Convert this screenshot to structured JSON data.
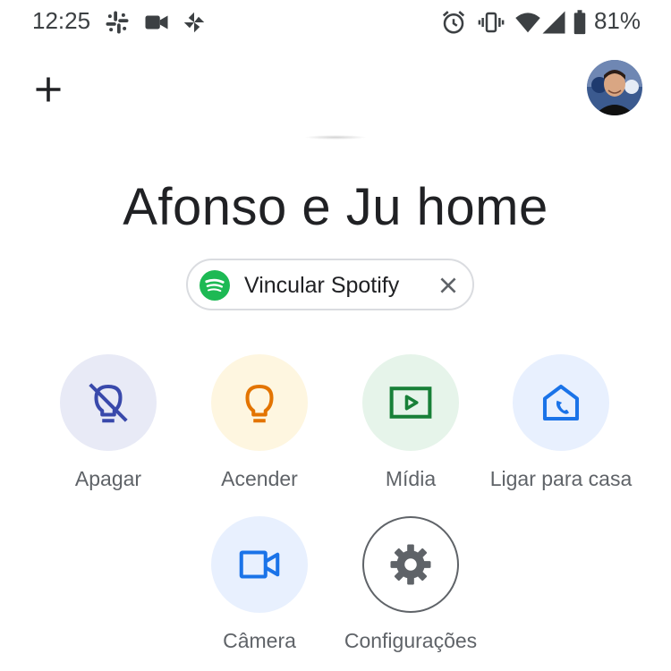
{
  "status_bar": {
    "time": "12:25",
    "battery": "81%",
    "left_icons": [
      "slack-icon",
      "video-call-icon",
      "pinwheel-app-icon"
    ],
    "right_icons": [
      "alarm-icon",
      "vibrate-icon",
      "wifi-icon",
      "signal-icon",
      "battery-icon"
    ]
  },
  "header": {
    "add_icon": "plus-icon",
    "avatar": "profile-avatar"
  },
  "home": {
    "title": "Afonso e Ju home"
  },
  "chip": {
    "label": "Vincular Spotify",
    "icon": "spotify-icon",
    "close_icon": "close-icon"
  },
  "actions": [
    {
      "label": "Apagar",
      "icon": "lightbulb-off-icon",
      "bg": "#e8eaf6",
      "fg": "#3949ab"
    },
    {
      "label": "Acender",
      "icon": "lightbulb-icon",
      "bg": "#fef6e0",
      "fg": "#e37400"
    },
    {
      "label": "Mídia",
      "icon": "play-media-icon",
      "bg": "#e6f4ea",
      "fg": "#188038"
    },
    {
      "label": "Ligar para casa",
      "icon": "home-call-icon",
      "bg": "#e8f0fe",
      "fg": "#1a73e8"
    },
    {
      "label": "Câmera",
      "icon": "camera-icon",
      "bg": "#e8f0fe",
      "fg": "#1a73e8"
    },
    {
      "label": "Configurações",
      "icon": "gear-icon",
      "bg": "#ffffff",
      "fg": "#5f6368"
    }
  ],
  "colors": {
    "spotify": "#1db954",
    "text_primary": "#202124",
    "text_secondary": "#5f6368"
  }
}
